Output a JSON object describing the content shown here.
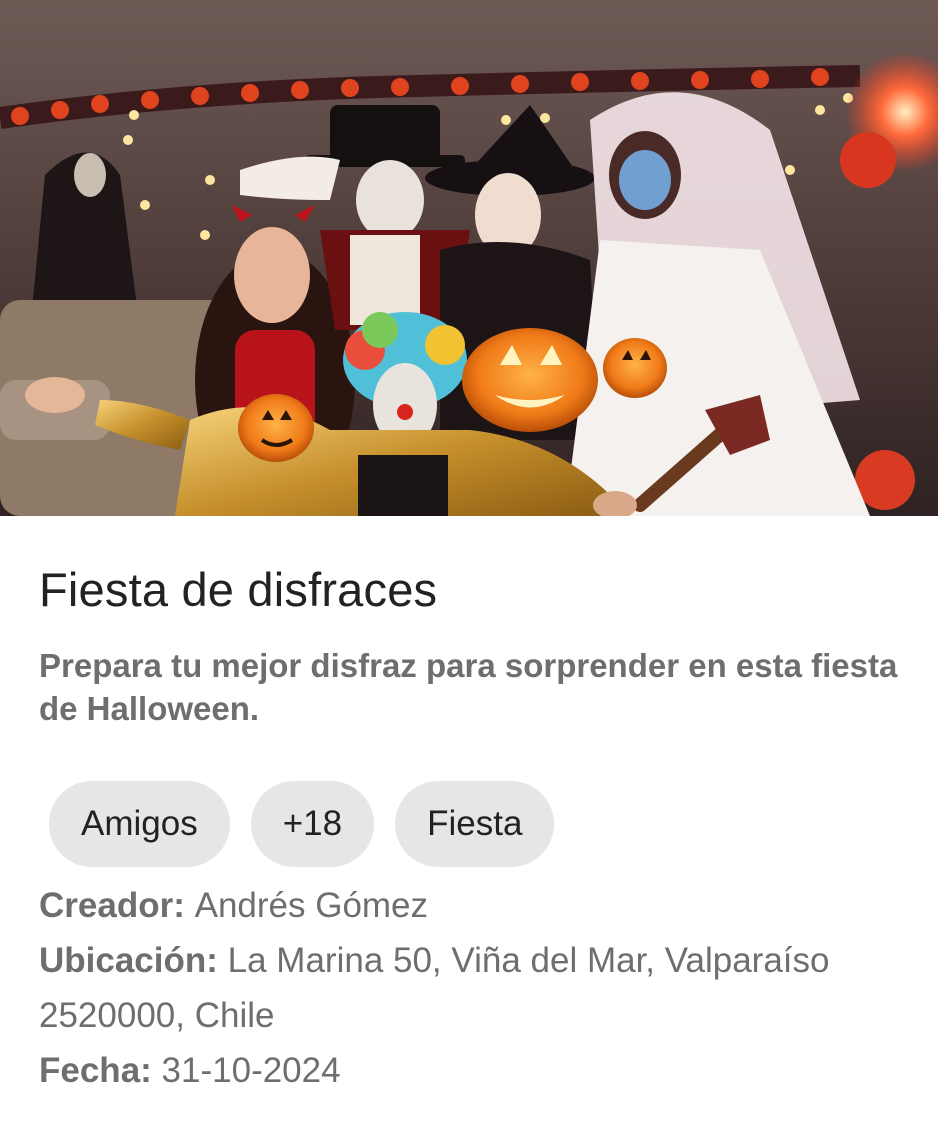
{
  "event": {
    "image_alt": "Grupo de amigos disfrazados en una fiesta de Halloween",
    "title": "Fiesta de disfraces",
    "description": "Prepara tu mejor disfraz para sorprender en esta fiesta de Halloween.",
    "tags": [
      "Amigos",
      "+18",
      "Fiesta"
    ],
    "creator_label": "Creador:",
    "creator_value": "Andrés Gómez",
    "location_label": "Ubicación:",
    "location_value": "La Marina 50, Viña del Mar, Valparaíso 2520000, Chile",
    "date_label": "Fecha:",
    "date_value": "31-10-2024"
  },
  "colors": {
    "title": "#222222",
    "body_text": "#6e6e6e",
    "chip_bg": "#e6e6e6"
  }
}
